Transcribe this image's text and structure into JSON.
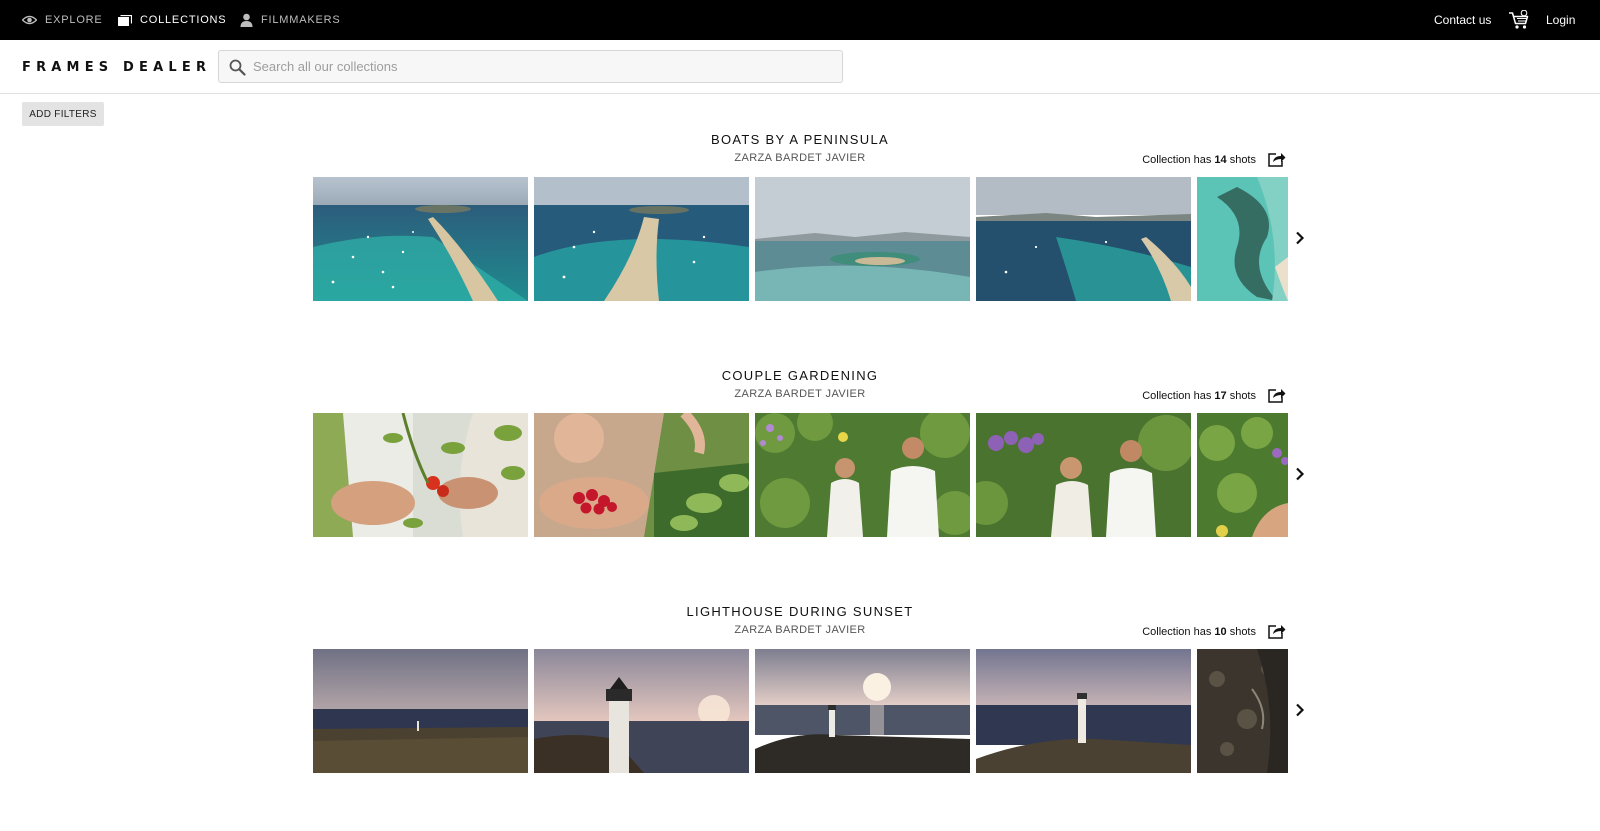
{
  "topnav": {
    "explore": "EXPLORE",
    "collections": "COLLECTIONS",
    "filmmakers": "FILMMAKERS",
    "contact": "Contact us",
    "login": "Login",
    "cart_icon": "cart-icon"
  },
  "header": {
    "logo": "FRAMES DEALER",
    "search_placeholder": "Search all our collections",
    "search_value": ""
  },
  "filters_label": "ADD FILTERS",
  "collections": [
    {
      "title": "BOATS BY A PENINSULA",
      "author": "ZARZA BARDET JAVIER",
      "shots_prefix": "Collection has ",
      "shots_count": "14",
      "shots_suffix": " shots",
      "theme": "sea"
    },
    {
      "title": "COUPLE GARDENING",
      "author": "ZARZA BARDET JAVIER",
      "shots_prefix": "Collection has ",
      "shots_count": "17",
      "shots_suffix": " shots",
      "theme": "garden"
    },
    {
      "title": "LIGHTHOUSE DURING SUNSET",
      "author": "ZARZA BARDET JAVIER",
      "shots_prefix": "Collection has ",
      "shots_count": "10",
      "shots_suffix": " shots",
      "theme": "sunset"
    }
  ],
  "colors": {
    "topbar": "#000000",
    "accent": "#111111",
    "filter_bg": "#e3e3e3"
  }
}
